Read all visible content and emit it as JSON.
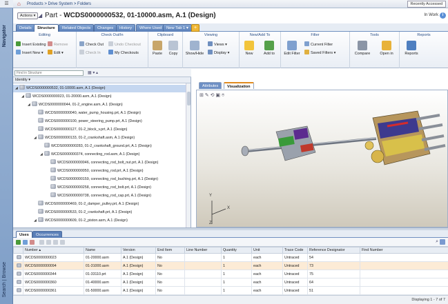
{
  "navigator": {
    "label": "Navigator",
    "search_label": "Search | Browse"
  },
  "header": {
    "breadcrumb": "Products > Drive System > Folders",
    "recent_label": "Recently Accessed"
  },
  "title": {
    "actions_label": "Actions",
    "prefix": "Part - ",
    "number": "WCDS0000000532, 01-10000.asm, A.1 (Design)",
    "state": "In Work"
  },
  "tabs": [
    "Details",
    "Structure",
    "Related Objects",
    "Changes",
    "History",
    "Where Used",
    "New Tab 1"
  ],
  "active_tab": "Structure",
  "ribbon": {
    "groups": [
      "Editing",
      "Check Out/In",
      "Clipboard",
      "Viewing",
      "New/Add To",
      "Filter",
      "Tools",
      "Reports"
    ],
    "editing": {
      "insert_existing": "Insert Existing",
      "remove": "Remove",
      "insert_new": "Insert New",
      "edit": "Edit"
    },
    "checkout": {
      "check_out": "Check Out",
      "undo_checkout": "Undo Checkout",
      "check_in": "Check In",
      "my_checkouts": "My Checkouts"
    },
    "clipboard": {
      "paste": "Paste",
      "copy": "Copy"
    },
    "viewing": {
      "show_hide": "Show/Hide",
      "views": "Views",
      "display": "Display"
    },
    "newadd": {
      "new": "New",
      "add_to": "Add to"
    },
    "filter": {
      "edit_filter": "Edit Filter",
      "current_filter": "Current Filter",
      "saved_filters": "Saved Filters"
    },
    "tools": {
      "compare": "Compare",
      "open_in": "Open in"
    },
    "reports": {
      "reports": "Reports"
    }
  },
  "find": {
    "placeholder": "Find in Structure"
  },
  "tree": {
    "header": "Identity",
    "rows": [
      {
        "level": 0,
        "label": "WCDS0000000532, 01-10000.asm, A.1 (Design)",
        "expanded": true,
        "selected": true
      },
      {
        "level": 1,
        "label": "WCDS0000000023, 01-20000.asm, A.1 (Design)",
        "expanded": true
      },
      {
        "level": 2,
        "label": "WCDS0000000044, 01-2_engine.asm, A.1 (Design)",
        "expanded": true
      },
      {
        "level": 3,
        "label": "WCDS0000000040, water_pump_housing.prt, A.1 (Design)"
      },
      {
        "level": 3,
        "label": "WCDS0000000100, power_steering_pump.prt, A.1 (Design)"
      },
      {
        "level": 3,
        "label": "WCDS0000000127, 01-2_block_v.prt, A.1 (Design)"
      },
      {
        "level": 3,
        "label": "WCDS0000000133, 01-2_crankshaft.asm, A.1 (Design)",
        "expanded": true
      },
      {
        "level": 4,
        "label": "WCDS0000000283, 01-2_crankshaft_ground.prt, A.1 (Design)"
      },
      {
        "level": 4,
        "label": "WCDS0000000374, connecting_rod.asm, A.1 (Design)",
        "expanded": true
      },
      {
        "level": 5,
        "label": "WCDS0000000046, connecting_rod_bolt_nut.prt, A.1 (Design)"
      },
      {
        "level": 5,
        "label": "WCDS0000000050, connecting_rod.prt, A.1 (Design)"
      },
      {
        "level": 5,
        "label": "WCDS0000000159, connecting_rod_buching.prt, A.1 (Design)"
      },
      {
        "level": 5,
        "label": "WCDS0000000258, connecting_rod_bolt.prt, A.1 (Design)"
      },
      {
        "level": 5,
        "label": "WCDS0000000738, connecting_rod_cap.prt, A.1 (Design)"
      },
      {
        "level": 3,
        "label": "WCDS0000000469, 01-2_damper_pulley.prt, A.1 (Design)"
      },
      {
        "level": 3,
        "label": "WCDS0000000533, 01-2_crankshaft.prt, A.1 (Design)"
      },
      {
        "level": 3,
        "label": "WCDS0000000609, 01-2_piston.asm, A.1 (Design)",
        "expanded": true
      }
    ]
  },
  "visualization": {
    "tabs": [
      "Attributes",
      "Visualization"
    ],
    "active_tab": "Visualization",
    "axis_x": "X",
    "axis_y": "Y",
    "axis_z": "Z"
  },
  "uses": {
    "tabs": [
      "Uses",
      "Occurrences"
    ],
    "active_tab": "Uses",
    "columns": [
      "Number",
      "Name",
      "Version",
      "End Item",
      "Line Number",
      "Quantity",
      "Unit",
      "Trace Code",
      "Reference Designator",
      "Find Number"
    ],
    "rows": [
      [
        "WCDS0000000023",
        "01-20000.asm",
        "A.1 (Design)",
        "No",
        "",
        "1",
        "each",
        "Untraced",
        "54",
        ""
      ],
      [
        "WCDS0000000094",
        "01-31000.asm",
        "A.1 (Design)",
        "No",
        "",
        "1",
        "each",
        "Untraced",
        "73",
        ""
      ],
      [
        "WCDS0000000344",
        "01-33110.prt",
        "A.1 (Design)",
        "No",
        "",
        "1",
        "each",
        "Untraced",
        "75",
        ""
      ],
      [
        "WCDS0000000360",
        "01-40000.asm",
        "A.1 (Design)",
        "No",
        "",
        "1",
        "each",
        "Untraced",
        "64",
        ""
      ],
      [
        "WCDS0000000361",
        "01-50000.asm",
        "A.1 (Design)",
        "No",
        "",
        "1",
        "each",
        "Untraced",
        "51",
        ""
      ]
    ],
    "highlighted_row": 1,
    "pager": "Displaying 1 - 7 of 7"
  },
  "colors": {
    "accent": "#5a7fb8",
    "highlight": "#fcebd6",
    "selection": "#c5d7f0"
  }
}
